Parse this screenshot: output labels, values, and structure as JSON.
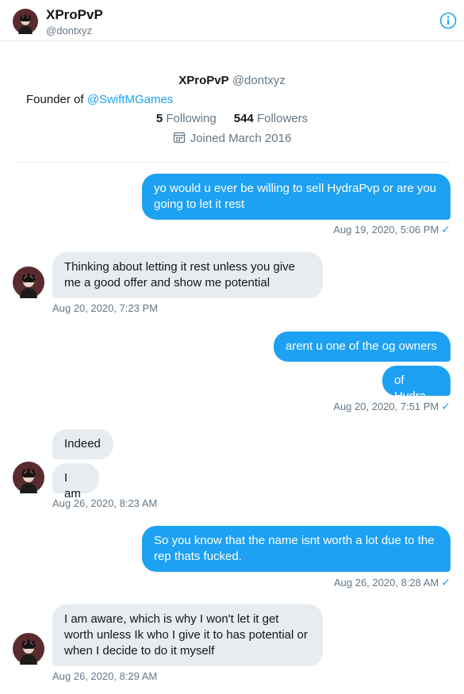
{
  "header": {
    "name": "XProPvP",
    "handle": "@dontxyz",
    "info_icon": "info-icon"
  },
  "profile": {
    "name": "XProPvP",
    "handle": "@dontxyz",
    "bio_prefix": "Founder of ",
    "bio_link": "@SwiftMGames",
    "following_count": "5",
    "following_label": "Following",
    "followers_count": "544",
    "followers_label": "Followers",
    "joined": "Joined March 2016",
    "calendar_icon": "calendar-icon"
  },
  "messages": [
    {
      "direction": "out",
      "lines": [
        "yo would u ever be willing to sell HydraPvp or are you",
        "going to let it rest"
      ],
      "timestamp": "Aug 19, 2020, 5:06 PM",
      "read": true
    },
    {
      "direction": "in",
      "lines": [
        "Thinking about letting it rest unless you give",
        "me a good offer and show me potential"
      ],
      "timestamp": "Aug 20, 2020, 7:23 PM"
    },
    {
      "direction": "out",
      "lines": [
        "arent u one of the og owners"
      ]
    },
    {
      "direction": "out",
      "lines": [
        "of Hydra"
      ],
      "timestamp": "Aug 20, 2020, 7:51 PM",
      "read": true
    },
    {
      "direction": "in",
      "lines": [
        "Indeed"
      ]
    },
    {
      "direction": "in",
      "lines": [
        "I am"
      ],
      "timestamp": "Aug 26, 2020, 8:23 AM"
    },
    {
      "direction": "out",
      "lines": [
        "So you know that the name isnt worth a lot due to the",
        "rep thats fucked."
      ],
      "timestamp": "Aug 26, 2020, 8:28 AM",
      "read": true
    },
    {
      "direction": "in",
      "lines": [
        "I am aware, which is why I won't let it get",
        "worth unless Ik who I give it to has potential or",
        "when I decide to do it myself"
      ],
      "timestamp": "Aug 26, 2020, 8:29 AM"
    }
  ],
  "read_mark": "✓",
  "colors": {
    "accent": "#1da1f2",
    "incoming_bubble": "#e6ecf0",
    "secondary_text": "#657786"
  }
}
